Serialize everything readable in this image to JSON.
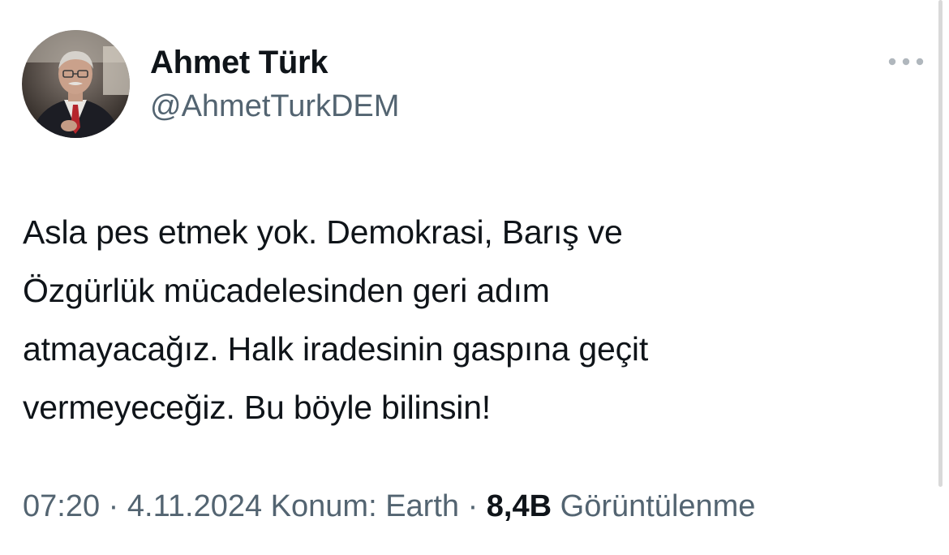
{
  "author": {
    "name": "Ahmet Türk",
    "handle": "@AhmetTurkDEM",
    "avatar_icon": "profile-photo"
  },
  "more_icon": "more-horizontal-icon",
  "tweet": {
    "lines": [
      "Asla pes etmek yok. Demokrasi, Barış ve",
      "Özgürlük mücadelesinden geri adım",
      "atmayacağız. Halk iradesinin gaspına geçit",
      "vermeyeceğiz. Bu böyle bilinsin!"
    ]
  },
  "meta": {
    "time": "07:20",
    "separator": "·",
    "date": "4.11.2024",
    "location": "Konum: Earth",
    "views_count": "8,4B",
    "views_label": "Görüntülenme"
  },
  "colors": {
    "text_primary": "#0f1419",
    "text_secondary": "#536471",
    "icon_gray": "#b0b7bd"
  }
}
